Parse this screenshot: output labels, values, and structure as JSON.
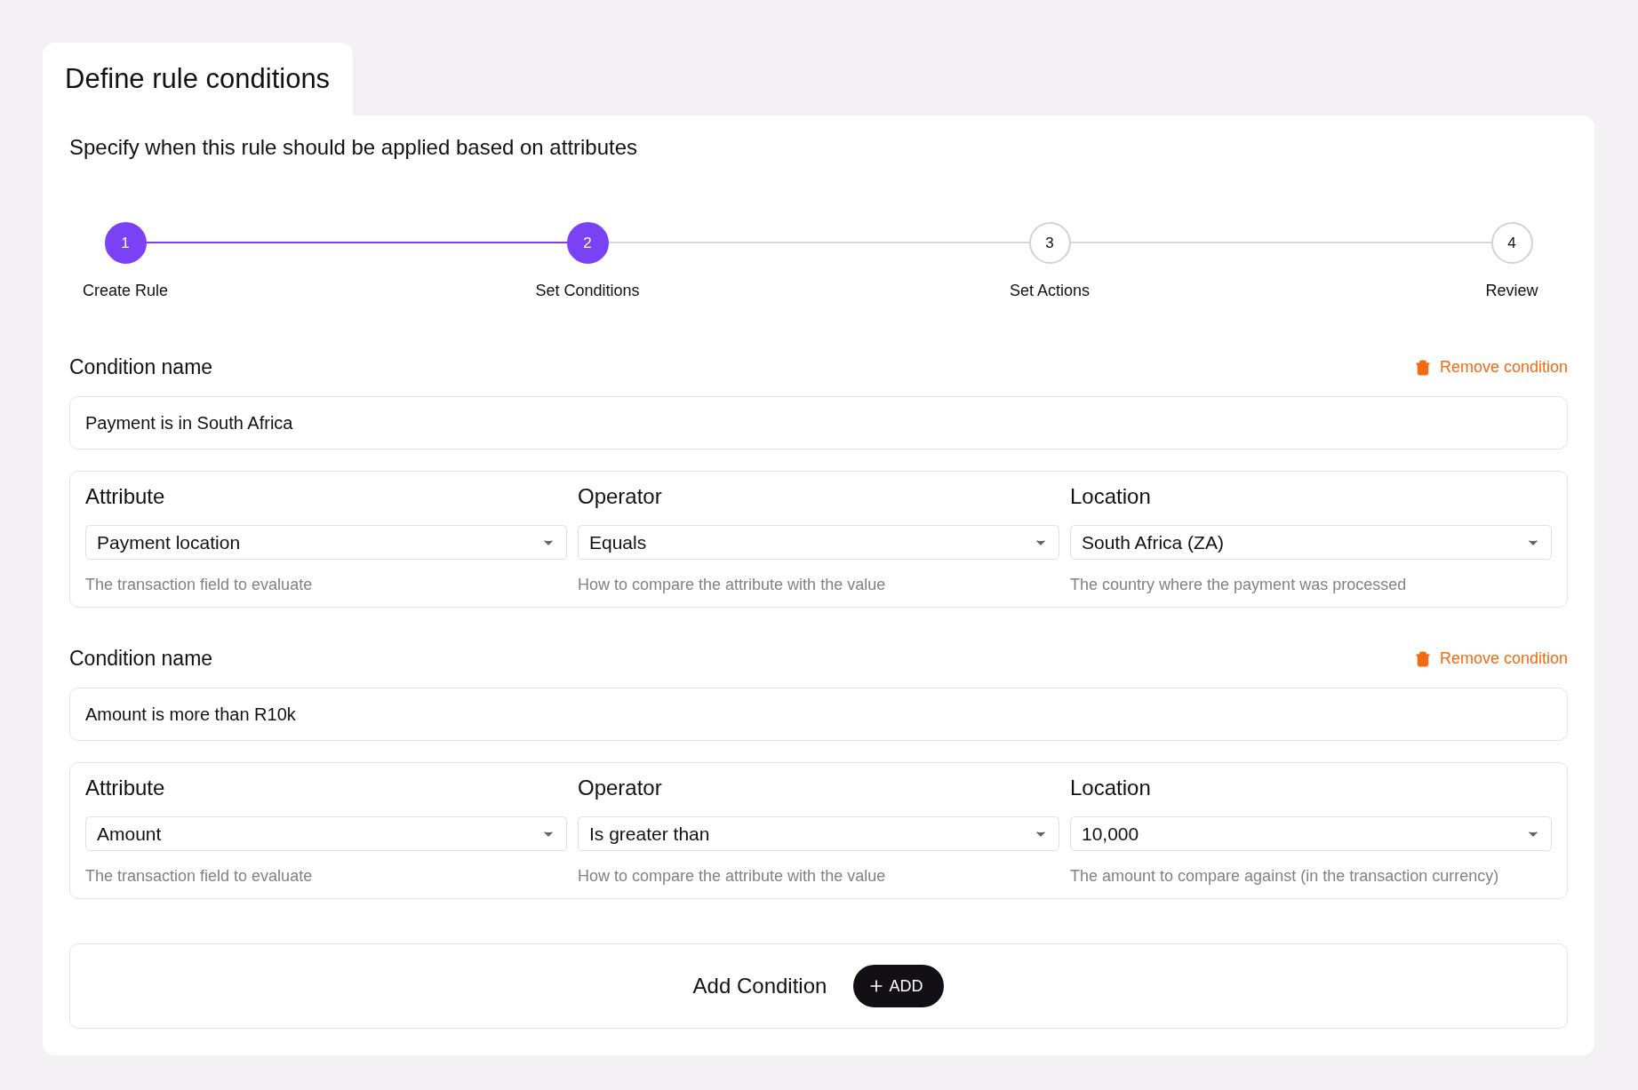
{
  "tab": {
    "title": "Define rule conditions"
  },
  "subtitle": "Specify when this rule should be applied based on attributes",
  "steps": [
    {
      "number": "1",
      "label": "Create Rule",
      "active": true
    },
    {
      "number": "2",
      "label": "Set Conditions",
      "active": true
    },
    {
      "number": "3",
      "label": "Set Actions",
      "active": false
    },
    {
      "number": "4",
      "label": "Review",
      "active": false
    }
  ],
  "conditions": [
    {
      "name_label": "Condition name",
      "remove_label": "Remove condition",
      "name_value": "Payment is in South Africa",
      "fields": [
        {
          "label": "Attribute",
          "value": "Payment location",
          "hint": "The transaction field to evaluate"
        },
        {
          "label": "Operator",
          "value": "Equals",
          "hint": "How to compare the attribute with the value"
        },
        {
          "label": "Location",
          "value": "South Africa (ZA)",
          "hint": "The country where the payment was processed"
        }
      ]
    },
    {
      "name_label": "Condition name",
      "remove_label": "Remove condition",
      "name_value": "Amount is more than R10k",
      "fields": [
        {
          "label": "Attribute",
          "value": "Amount",
          "hint": "The transaction field to evaluate"
        },
        {
          "label": "Operator",
          "value": "Is greater than",
          "hint": "How to compare the attribute with the value"
        },
        {
          "label": "Location",
          "value": "10,000",
          "hint": "The amount to compare against (in the transaction currency)"
        }
      ]
    }
  ],
  "add": {
    "label": "Add Condition",
    "button": "ADD"
  }
}
